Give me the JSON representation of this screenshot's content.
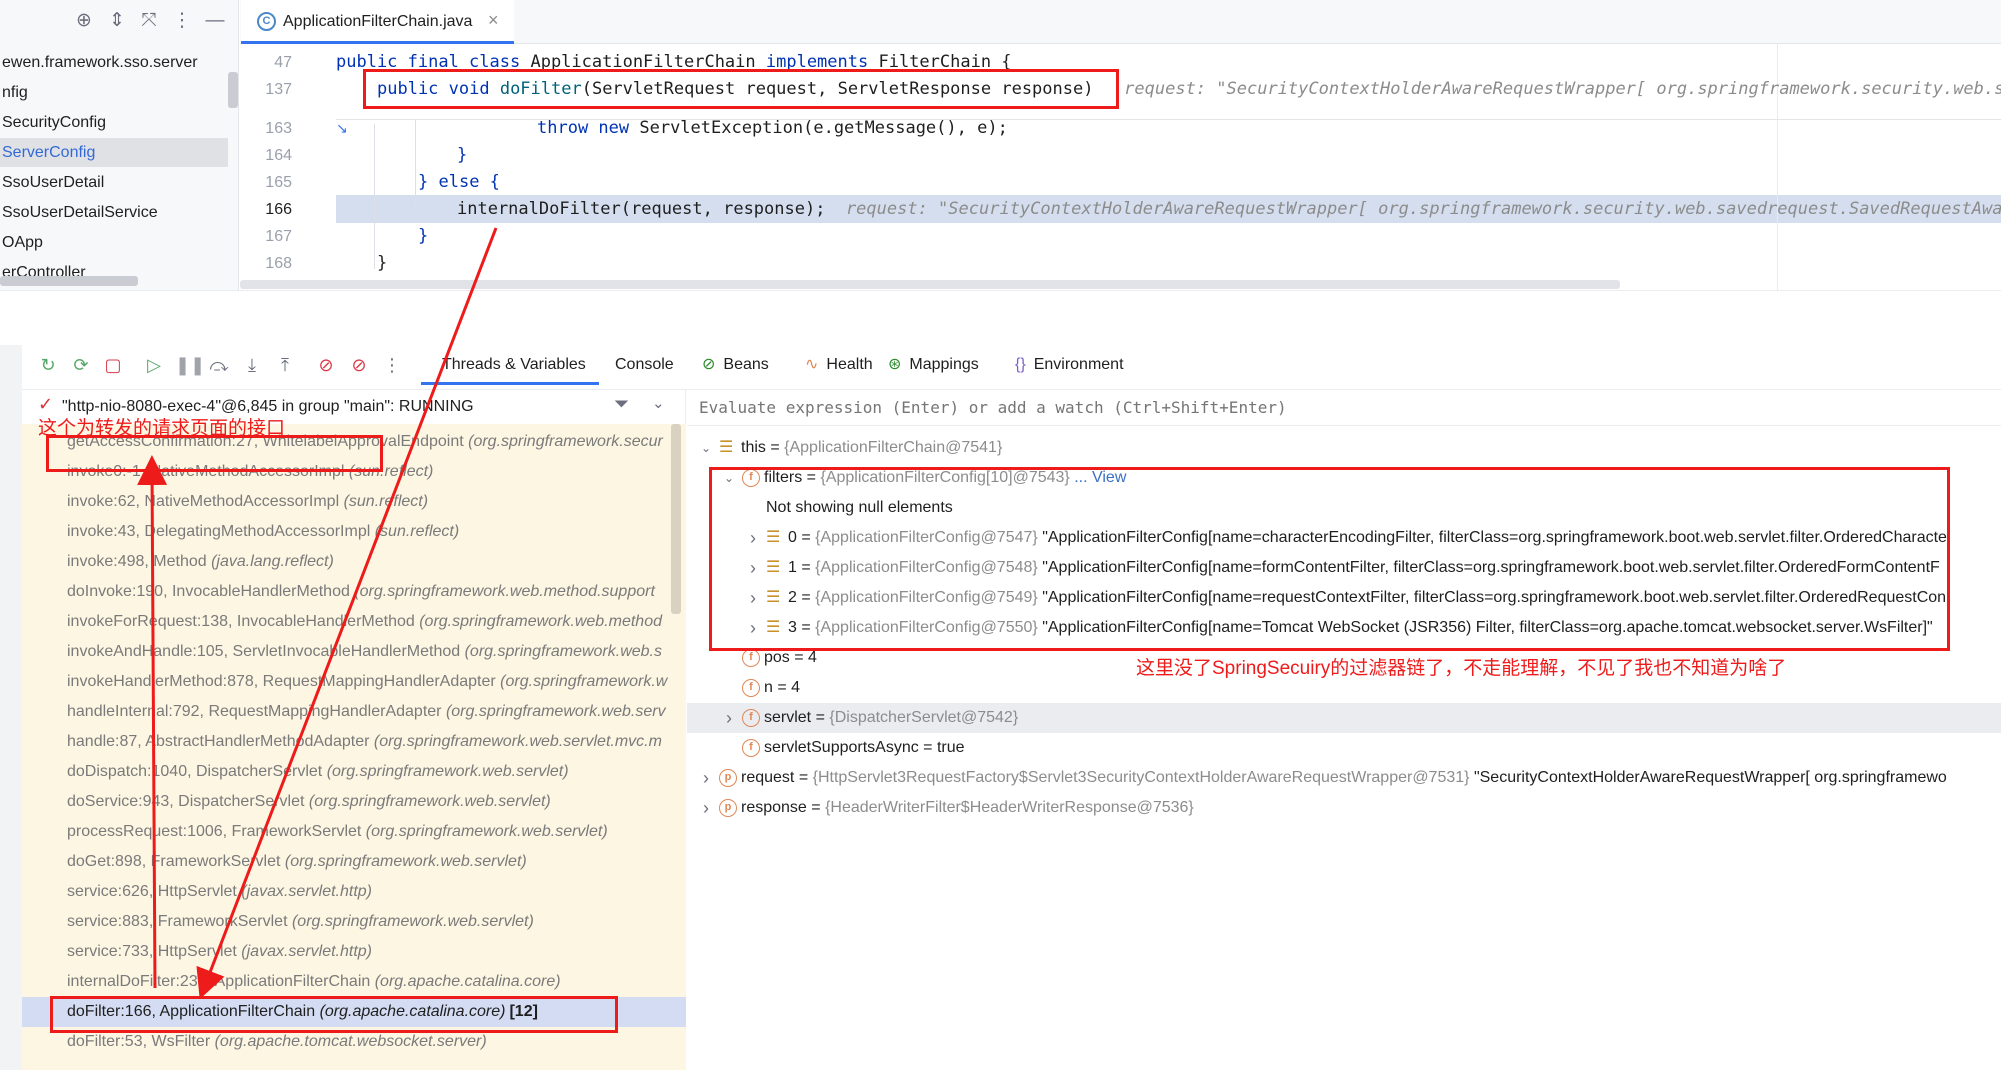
{
  "project_tree": {
    "items": [
      {
        "label": "ewen.framework.sso.server"
      },
      {
        "label": "nfig"
      },
      {
        "label": "SecurityConfig"
      },
      {
        "label": "ServerConfig"
      },
      {
        "label": "SsoUserDetail"
      },
      {
        "label": "SsoUserDetailService"
      },
      {
        "label": "OApp"
      },
      {
        "label": "erController"
      }
    ],
    "selected_index": 3
  },
  "editor": {
    "tab_label": "ApplicationFilterChain.java",
    "tab_close": "×",
    "tab_icon_glyph": "C",
    "lines": [
      {
        "num": "47",
        "code": [
          {
            "t": "public final class ",
            "c": "kw"
          },
          {
            "t": "ApplicationFilterChain "
          },
          {
            "t": "implements ",
            "c": "kw"
          },
          {
            "t": "FilterChain {"
          }
        ]
      },
      {
        "num": "137",
        "code": [
          {
            "t": "public void ",
            "c": "kw"
          },
          {
            "t": "doFilter",
            "c": "fn"
          },
          {
            "t": "(ServletRequest request, ServletResponse response)"
          },
          {
            "t": "   request: \"SecurityContextHolderAwareRequestWrapper[ org.springframework.security.web.saved",
            "c": "inlay"
          }
        ]
      },
      {
        "num": "163",
        "code": [
          {
            "t": "throw new ",
            "c": "kw"
          },
          {
            "t": "ServletException(e.getMessage(), e);"
          }
        ]
      },
      {
        "num": "164",
        "code": [
          {
            "t": "}",
            "c": "kw"
          }
        ]
      },
      {
        "num": "165",
        "code": [
          {
            "t": "} ",
            "c": "kw"
          },
          {
            "t": "else ",
            "c": "kw"
          },
          {
            "t": "{",
            "c": "kw"
          }
        ]
      },
      {
        "num": "166",
        "code": [
          {
            "t": "internalDoFilter(request, response);"
          },
          {
            "t": "  request: \"SecurityContextHolderAwareRequestWrapper[ org.springframework.security.web.savedrequest.SavedRequestAwareW",
            "c": "inlay"
          }
        ]
      },
      {
        "num": "167",
        "code": [
          {
            "t": "}",
            "c": "kw"
          }
        ]
      },
      {
        "num": "168",
        "code": [
          {
            "t": "}"
          }
        ]
      }
    ],
    "current_line": "166"
  },
  "debug": {
    "toolbar_tabs": [
      {
        "label": "Threads & Variables",
        "icon": "",
        "active": true
      },
      {
        "label": "Console",
        "icon": ""
      },
      {
        "label": "Beans",
        "icon": "beans-icon"
      },
      {
        "label": "Health",
        "icon": "health-icon"
      },
      {
        "label": "Mappings",
        "icon": "mappings-icon"
      },
      {
        "label": "Environment",
        "icon": "environment-icon"
      }
    ],
    "thread_label": "\"http-nio-8080-exec-4\"@6,845 in group \"main\": RUNNING",
    "frames": [
      {
        "m": "getAccessConfirmation:27, WhitelabelApprovalEndpoint ",
        "p": "(org.springframework.secur"
      },
      {
        "m": "invoke0:-1, NativeMethodAccessorImpl ",
        "p": "(sun.reflect)"
      },
      {
        "m": "invoke:62, NativeMethodAccessorImpl ",
        "p": "(sun.reflect)"
      },
      {
        "m": "invoke:43, DelegatingMethodAccessorImpl ",
        "p": "(sun.reflect)"
      },
      {
        "m": "invoke:498, Method ",
        "p": "(java.lang.reflect)"
      },
      {
        "m": "doInvoke:190, InvocableHandlerMethod ",
        "p": "(org.springframework.web.method.support"
      },
      {
        "m": "invokeForRequest:138, InvocableHandlerMethod ",
        "p": "(org.springframework.web.method"
      },
      {
        "m": "invokeAndHandle:105, ServletInvocableHandlerMethod ",
        "p": "(org.springframework.web.s"
      },
      {
        "m": "invokeHandlerMethod:878, RequestMappingHandlerAdapter ",
        "p": "(org.springframework.w"
      },
      {
        "m": "handleInternal:792, RequestMappingHandlerAdapter ",
        "p": "(org.springframework.web.serv"
      },
      {
        "m": "handle:87, AbstractHandlerMethodAdapter ",
        "p": "(org.springframework.web.servlet.mvc.m"
      },
      {
        "m": "doDispatch:1040, DispatcherServlet ",
        "p": "(org.springframework.web.servlet)"
      },
      {
        "m": "doService:943, DispatcherServlet ",
        "p": "(org.springframework.web.servlet)"
      },
      {
        "m": "processRequest:1006, FrameworkServlet ",
        "p": "(org.springframework.web.servlet)"
      },
      {
        "m": "doGet:898, FrameworkServlet ",
        "p": "(org.springframework.web.servlet)"
      },
      {
        "m": "service:626, HttpServlet ",
        "p": "(javax.servlet.http)"
      },
      {
        "m": "service:883, FrameworkServlet ",
        "p": "(org.springframework.web.servlet)"
      },
      {
        "m": "service:733, HttpServlet ",
        "p": "(javax.servlet.http)"
      },
      {
        "m": "internalDoFilter:231, ApplicationFilterChain ",
        "p": "(org.apache.catalina.core)"
      },
      {
        "m": "doFilter:166, ApplicationFilterChain ",
        "p": "(org.apache.catalina.core)",
        "count": "[12]",
        "current": true
      },
      {
        "m": "doFilter:53, WsFilter ",
        "p": "(org.apache.tomcat.websocket.server)"
      }
    ],
    "eval_placeholder": "Evaluate expression (Enter) or add a watch (Ctrl+Shift+Enter)",
    "variables": [
      {
        "level": 0,
        "arrow": "down",
        "icon": "array",
        "name": "this",
        "eq": " = ",
        "type": "{ApplicationFilterChain@7541}",
        "val": ""
      },
      {
        "level": 1,
        "arrow": "down",
        "icon": "field",
        "name": "filters",
        "eq": " = ",
        "type": "{ApplicationFilterConfig[10]@7543}",
        "val": "",
        "link": " ... View"
      },
      {
        "level": 2,
        "arrow": "",
        "icon": "",
        "name": "",
        "eq": "",
        "type": "",
        "val": "Not showing null elements"
      },
      {
        "level": 2,
        "arrow": "right",
        "icon": "array",
        "name": "0",
        "eq": " = ",
        "type": "{ApplicationFilterConfig@7547}",
        "val": " \"ApplicationFilterConfig[name=characterEncodingFilter, filterClass=org.springframework.boot.web.servlet.filter.OrderedCharacte"
      },
      {
        "level": 2,
        "arrow": "right",
        "icon": "array",
        "name": "1",
        "eq": " = ",
        "type": "{ApplicationFilterConfig@7548}",
        "val": " \"ApplicationFilterConfig[name=formContentFilter, filterClass=org.springframework.boot.web.servlet.filter.OrderedFormContentF"
      },
      {
        "level": 2,
        "arrow": "right",
        "icon": "array",
        "name": "2",
        "eq": " = ",
        "type": "{ApplicationFilterConfig@7549}",
        "val": " \"ApplicationFilterConfig[name=requestContextFilter, filterClass=org.springframework.boot.web.servlet.filter.OrderedRequestCon"
      },
      {
        "level": 2,
        "arrow": "right",
        "icon": "array",
        "name": "3",
        "eq": " = ",
        "type": "{ApplicationFilterConfig@7550}",
        "val": " \"ApplicationFilterConfig[name=Tomcat WebSocket (JSR356) Filter, filterClass=org.apache.tomcat.websocket.server.WsFilter]\""
      },
      {
        "level": 1,
        "arrow": "",
        "icon": "field",
        "name": "pos",
        "eq": " = ",
        "type": "",
        "val": "4"
      },
      {
        "level": 1,
        "arrow": "",
        "icon": "field",
        "name": "n",
        "eq": " = ",
        "type": "",
        "val": "4"
      },
      {
        "level": 1,
        "arrow": "right",
        "icon": "field",
        "name": "servlet",
        "eq": " = ",
        "type": "{DispatcherServlet@7542}",
        "val": "",
        "selected": true
      },
      {
        "level": 1,
        "arrow": "",
        "icon": "field",
        "name": "servletSupportsAsync",
        "eq": " = ",
        "type": "",
        "val": "true"
      },
      {
        "level": 0,
        "arrow": "right",
        "icon": "param",
        "name": "request",
        "eq": " = ",
        "type": "{HttpServlet3RequestFactory$Servlet3SecurityContextHolderAwareRequestWrapper@7531}",
        "val": " \"SecurityContextHolderAwareRequestWrapper[ org.springframewo"
      },
      {
        "level": 0,
        "arrow": "right",
        "icon": "param",
        "name": "response",
        "eq": " = ",
        "type": "{HeaderWriterFilter$HeaderWriterResponse@7536}",
        "val": ""
      }
    ]
  },
  "annotations": {
    "forward_note": "这个为转发的请求页面的接口",
    "filter_note": "这里没了SpringSecuiry的过滤器链了，不走能理解，不见了我也不知道为啥了",
    "color": "#ee1b1b"
  }
}
